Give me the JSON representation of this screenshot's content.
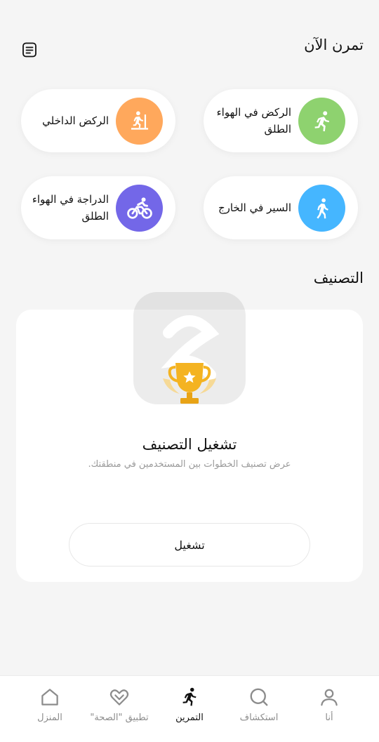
{
  "header": {
    "title": "تمرن الآن",
    "records_icon": "document-list-icon"
  },
  "workouts": [
    {
      "label": "الركض في الهواء الطلق",
      "icon": "outdoor-run-icon",
      "color": "#8ed26f"
    },
    {
      "label": "الركض الداخلي",
      "icon": "treadmill-icon",
      "color": "#ffa85c"
    },
    {
      "label": "السير في الخارج",
      "icon": "walk-icon",
      "color": "#45b6ff"
    },
    {
      "label": "الدراجة في الهواء الطلق",
      "icon": "bike-icon",
      "color": "#7367e8"
    }
  ],
  "ranking": {
    "section_title": "التصنيف",
    "title": "تشغيل التصنيف",
    "description": "عرض تصنيف الخطوات بين المستخدمين في منطقتك.",
    "button": "تشغيل",
    "trophy_icon": "trophy-icon"
  },
  "nav": [
    {
      "label": "أنا",
      "icon": "person-icon",
      "active": false
    },
    {
      "label": "استكشاف",
      "icon": "search-icon",
      "active": false
    },
    {
      "label": "التمرين",
      "icon": "running-icon",
      "active": true
    },
    {
      "label": "تطبيق \"الصحة\"",
      "icon": "heart-icon",
      "active": false
    },
    {
      "label": "المنزل",
      "icon": "home-icon",
      "active": false
    }
  ],
  "colors": {
    "background": "#f5f5f5",
    "card": "#ffffff",
    "muted_text": "#9a9a9a",
    "trophy": "#f4b321"
  }
}
